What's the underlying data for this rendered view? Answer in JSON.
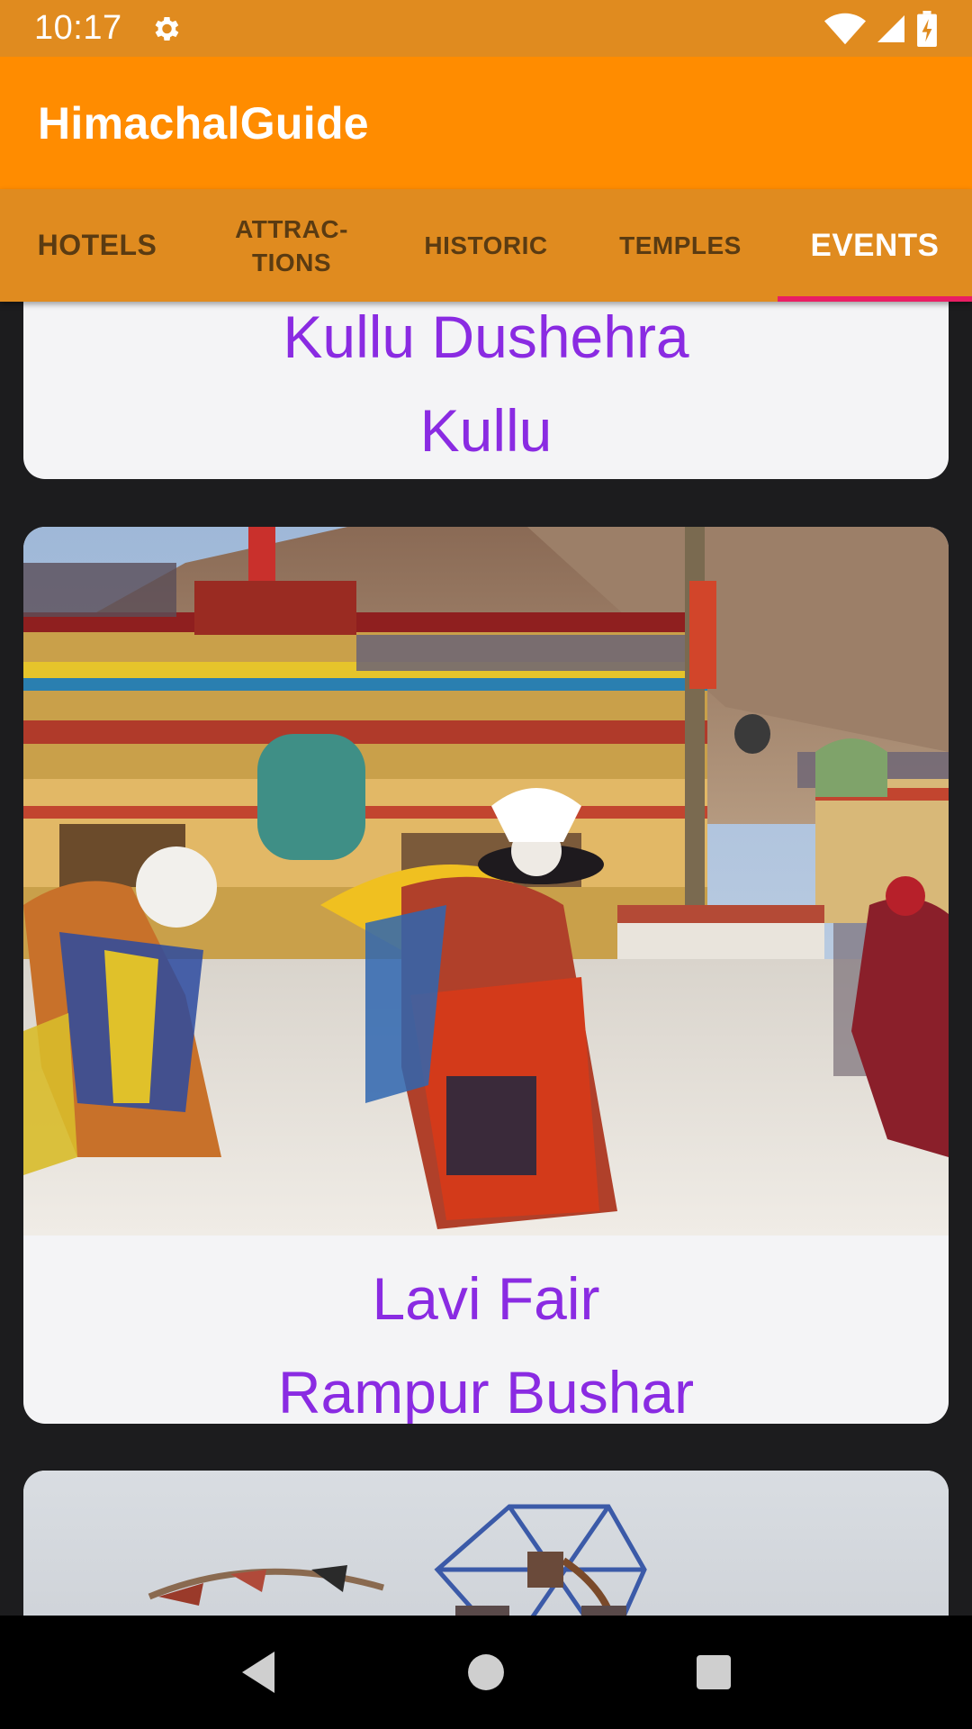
{
  "status_bar": {
    "time": "10:17",
    "icons": [
      "gear-icon",
      "wifi-icon",
      "signal-icon",
      "battery-icon"
    ]
  },
  "app_bar": {
    "title": "HimachalGuide"
  },
  "tabs": [
    {
      "label": "HOTELS",
      "active": false
    },
    {
      "label": "ATTRAC-\nTIONS",
      "active": false
    },
    {
      "label": "HISTORIC",
      "active": false
    },
    {
      "label": "TEMPLES",
      "active": false
    },
    {
      "label": "EVENTS",
      "active": true
    }
  ],
  "events": [
    {
      "name": "Kullu Dushehra",
      "location": "Kullu"
    },
    {
      "name": "Lavi Fair",
      "location": "Rampur Bushar",
      "image": "festival-dancers-photo"
    },
    {
      "image": "ferris-wheel-fair-photo"
    }
  ],
  "colors": {
    "status_bar": "#e08b1f",
    "app_bar": "#ff8c00",
    "tab_bar": "#e08b1f",
    "tab_indicator": "#e91e63",
    "card_text": "#8a2be2",
    "card_bg": "#f4f4f6",
    "background": "#1c1c1e"
  },
  "nav_bar": {
    "buttons": [
      "back-icon",
      "home-icon",
      "recents-icon"
    ]
  }
}
